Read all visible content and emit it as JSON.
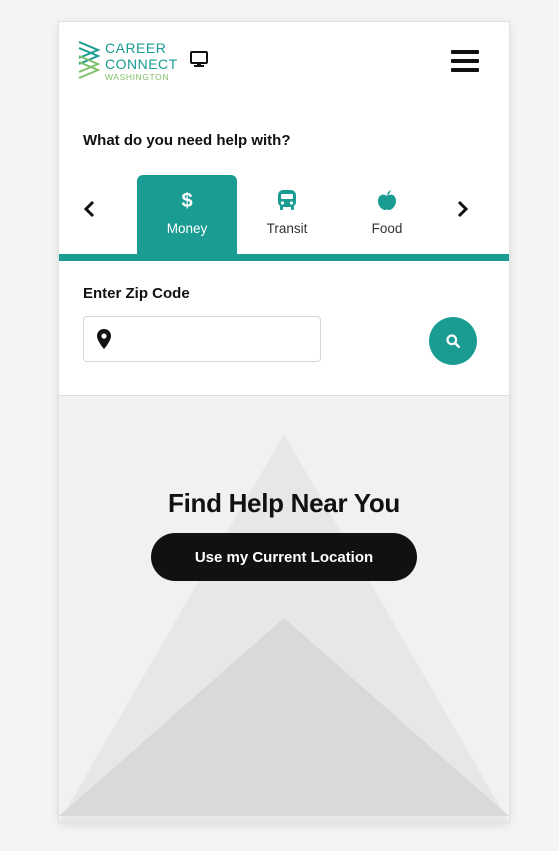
{
  "header": {
    "logo": {
      "line1": "CAREER",
      "line2": "CONNECT",
      "line3": "WASHINGTON"
    },
    "icons": [
      "monitor-icon",
      "hamburger-menu-icon"
    ]
  },
  "help": {
    "title": "What do you need help with?",
    "tabs": [
      {
        "label": "Money",
        "icon": "dollar-icon",
        "active": true
      },
      {
        "label": "Transit",
        "icon": "bus-icon",
        "active": false
      },
      {
        "label": "Food",
        "icon": "apple-icon",
        "active": false
      }
    ]
  },
  "zip": {
    "title": "Enter Zip Code",
    "value": "",
    "placeholder": ""
  },
  "hero": {
    "title": "Find Help Near You",
    "button_label": "Use my Current Location"
  },
  "colors": {
    "accent": "#1a9c92",
    "logo_green": "#7fc16a",
    "button_dark": "#111111"
  }
}
